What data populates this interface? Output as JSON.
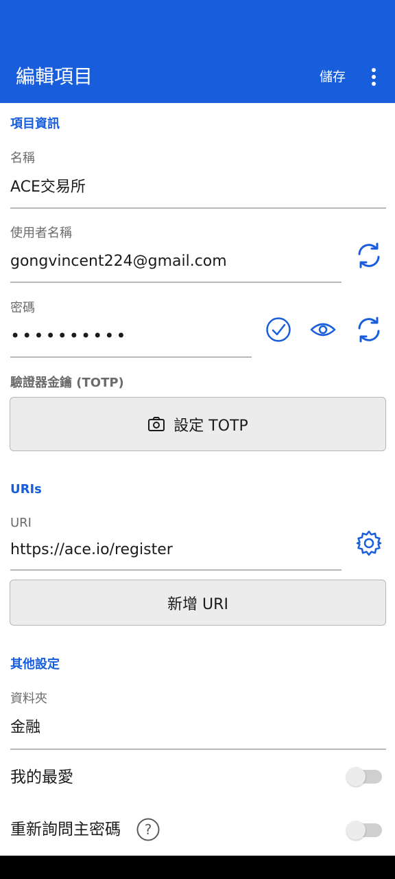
{
  "header": {
    "title": "編輯項目",
    "save_label": "儲存",
    "more_icon": "more-vertical-icon"
  },
  "item_info": {
    "section_title": "項目資訊",
    "name": {
      "label": "名稱",
      "value": "ACE交易所"
    },
    "username": {
      "label": "使用者名稱",
      "value": "gongvincent224@gmail.com"
    },
    "password": {
      "label": "密碼",
      "value": "••••••••••"
    },
    "totp": {
      "label": "驗證器金鑰 (TOTP)",
      "button_label": "設定 TOTP"
    }
  },
  "uris": {
    "section_title": "URIs",
    "uri": {
      "label": "URI",
      "value": "https://ace.io/register"
    },
    "add_button_label": "新增 URI"
  },
  "other": {
    "section_title": "其他設定",
    "folder": {
      "label": "資料夾",
      "value": "金融"
    },
    "favorite": {
      "label": "我的最愛",
      "enabled": false
    },
    "reprompt": {
      "label": "重新詢問主密碼",
      "enabled": false,
      "help_icon": "?"
    }
  },
  "colors": {
    "primary": "#175ddc",
    "accent_icon": "#175ddc",
    "divider": "#b8b8b8"
  }
}
